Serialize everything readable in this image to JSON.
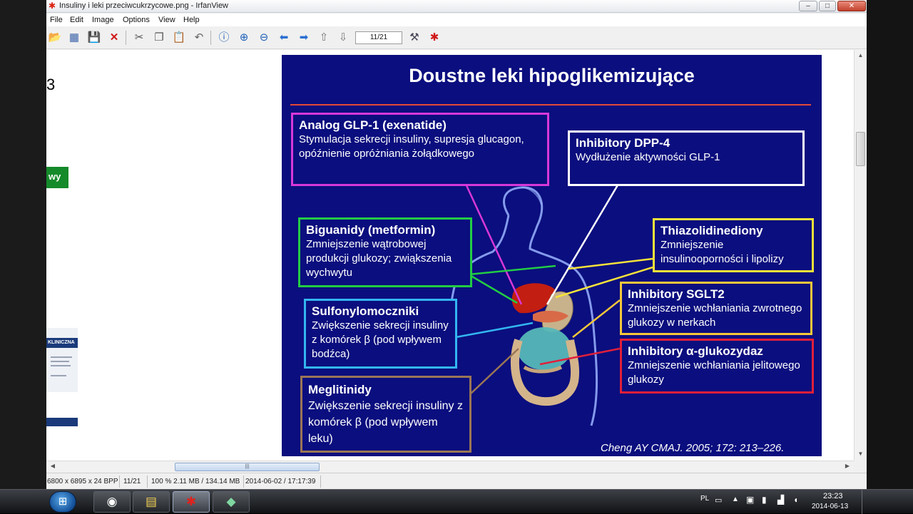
{
  "window": {
    "title": "Insuliny i leki przeciwcukrzycowe.png - IrfanView",
    "minimize": "–",
    "maximize": "□",
    "close": "✕"
  },
  "menu": [
    "File",
    "Edit",
    "Image",
    "Options",
    "View",
    "Help"
  ],
  "toolbar": {
    "page_value": "11/21",
    "icons": [
      "open-icon",
      "slideshow-icon",
      "save-icon",
      "delete-icon",
      "cut-icon",
      "copy-icon",
      "paste-icon",
      "undo-icon",
      "info-icon",
      "zoom-in-icon",
      "zoom-out-icon",
      "previous-icon",
      "next-icon",
      "page-up-icon",
      "page-down-icon",
      "settings-icon",
      "irfanview-icon"
    ]
  },
  "left_fragments": {
    "number": "3",
    "green_label": "wy",
    "doc_title": "KLINICZNA"
  },
  "slide": {
    "title": "Doustne leki hipoglikemizujące",
    "citation": "Cheng AY CMAJ. 2005; 172: 213–226.",
    "boxes": [
      {
        "id": "glp1",
        "title": "Analog GLP-1  (exenatide)",
        "text": "Stymulacja sekrecji insuliny, supresja glucagon, opóźnienie opróżniania żołądkowego",
        "color": "#d838d8"
      },
      {
        "id": "dpp4",
        "title": "Inhibitory DPP-4",
        "text": "Wydłużenie aktywności  GLP-1",
        "color": "#ffffff"
      },
      {
        "id": "biguanidy",
        "title": "Biguanidy (metformin)",
        "text": "Zmniejszenie wątrobowej produkcji glukozy; zwiąkszenia wychwytu",
        "color": "#22cc44"
      },
      {
        "id": "thiazolidinediony",
        "title": "Thiazolidinediony",
        "text": "Zmniejszenie insulinooporności i lipolizy",
        "color": "#f5e23a"
      },
      {
        "id": "sglt2",
        "title": "Inhibitory SGLT2",
        "text": "Zmniejszenie wchłaniania zwrotnego glukozy w nerkach",
        "color": "#f5c73a"
      },
      {
        "id": "sulfonylomoczniki",
        "title": "Sulfonylomoczniki",
        "text": "Zwiększenie sekrecji insuliny z komórek β (pod wpływem bodźca)",
        "color": "#33b6f0"
      },
      {
        "id": "alfa",
        "title": "Inhibitory α-glukozydaz",
        "text": "Zmniejszenie wchłaniania jelitowego glukozy",
        "color": "#e01f3a"
      },
      {
        "id": "meglitinidy",
        "title": "Meglitinidy",
        "text": "Zwiększenie sekrecji insuliny z komórek β (pod wpływem leku)",
        "color": "#9a7656"
      }
    ]
  },
  "status": {
    "dimensions": "6800 x 6895 x 24 BPP",
    "page": "11/21",
    "zoom_memory": "100 % 2.11 MB / 134.14 MB",
    "datetime": "2014-06-02 / 17:17:39"
  },
  "taskbar": {
    "language": "PL",
    "time": "23:23",
    "date": "2014-06-13"
  }
}
